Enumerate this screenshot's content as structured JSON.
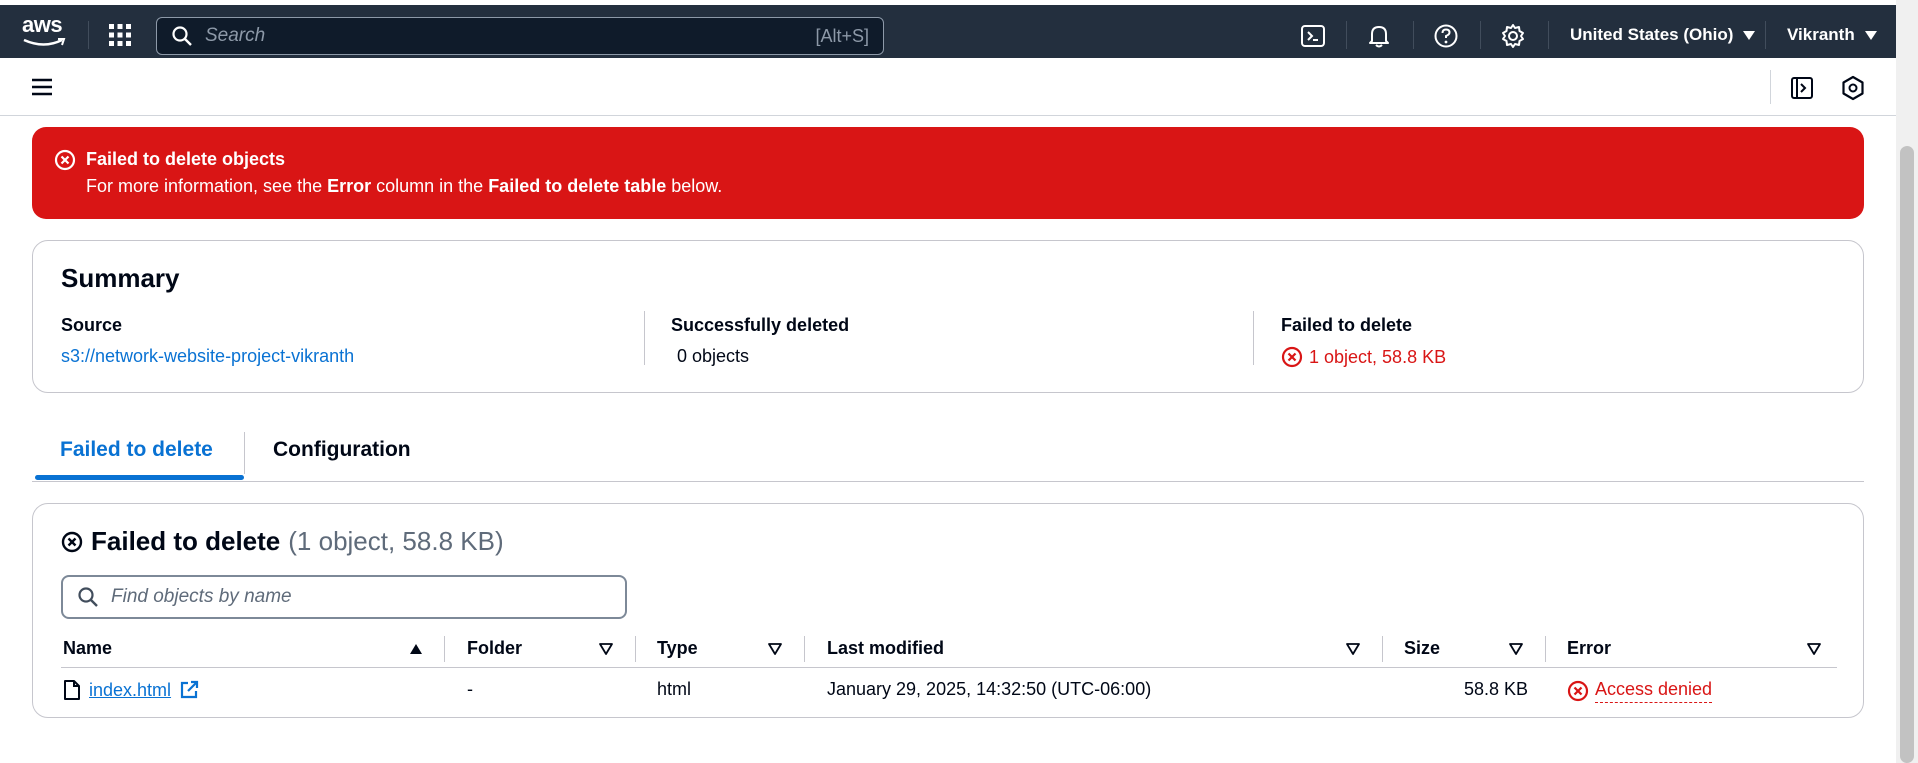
{
  "topnav": {
    "logo_text": "aws",
    "search_placeholder": "Search",
    "search_shortcut": "[Alt+S]",
    "icons": [
      "grid-icon",
      "cloudshell-icon",
      "bell-icon",
      "help-icon",
      "gear-icon"
    ],
    "region": "United States (Ohio)",
    "user": "Vikranth"
  },
  "subbar": {
    "icons": [
      "hamburger-icon",
      "side-panel-icon",
      "hexagon-settings-icon"
    ]
  },
  "alert": {
    "title": "Failed to delete objects",
    "body_prefix": "For more information, see the ",
    "body_bold1": "Error",
    "body_mid": " column in the ",
    "body_bold2": "Failed to delete table",
    "body_suffix": " below.",
    "color": "#d91515"
  },
  "summary": {
    "title": "Summary",
    "source_label": "Source",
    "source_value": "s3://network-website-project-vikranth",
    "success_label": "Successfully deleted",
    "success_value": "0 objects",
    "failed_label": "Failed to delete",
    "failed_value": "1 object, 58.8 KB"
  },
  "tabs": [
    {
      "label": "Failed to delete",
      "active": true
    },
    {
      "label": "Configuration",
      "active": false
    }
  ],
  "failed_table": {
    "title": "Failed to delete",
    "count": "(1 object, 58.8 KB)",
    "find_placeholder": "Find objects by name",
    "columns": [
      "Name",
      "Folder",
      "Type",
      "Last modified",
      "Size",
      "Error"
    ],
    "rows": [
      {
        "name": "index.html",
        "folder": "-",
        "type": "html",
        "last_modified": "January 29, 2025, 14:32:50 (UTC-06:00)",
        "size": "58.8 KB",
        "error": "Access denied"
      }
    ]
  },
  "colors": {
    "nav_bg": "#232f3e",
    "link": "#0972d3",
    "error": "#d91515"
  }
}
